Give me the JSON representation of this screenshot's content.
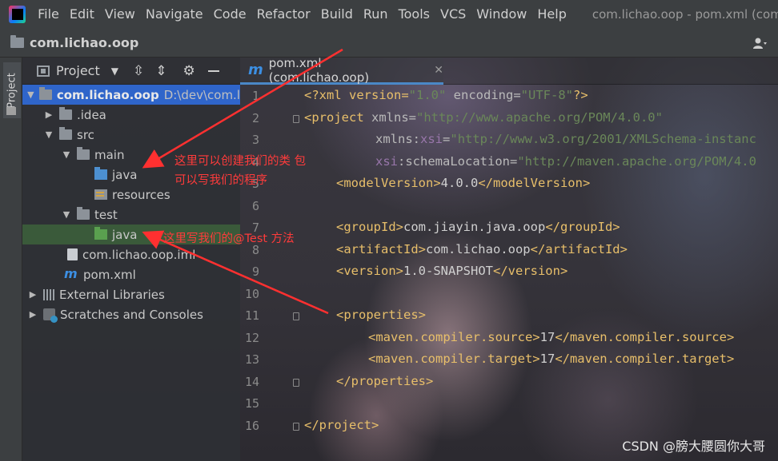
{
  "menu": {
    "items": [
      "File",
      "Edit",
      "View",
      "Navigate",
      "Code",
      "Refactor",
      "Build",
      "Run",
      "Tools",
      "VCS",
      "Window",
      "Help"
    ],
    "title": "com.lichao.oop - pom.xml (com."
  },
  "nav": {
    "project": "com.lichao.oop"
  },
  "sidestrip": {
    "project_tab": "Project"
  },
  "panel": {
    "title": "Project",
    "tree": [
      {
        "label": "com.lichao.oop",
        "path": "D:\\dev\\com.l"
      },
      {
        "label": ".idea"
      },
      {
        "label": "src"
      },
      {
        "label": "main"
      },
      {
        "label": "java"
      },
      {
        "label": "resources"
      },
      {
        "label": "test"
      },
      {
        "label": "java"
      },
      {
        "label": "com.lichao.oop.iml"
      },
      {
        "label": "pom.xml"
      },
      {
        "label": "External Libraries"
      },
      {
        "label": "Scratches and Consoles"
      }
    ]
  },
  "editor": {
    "tab": {
      "icon": "m",
      "label": "pom.xml (com.lichao.oop)"
    },
    "line_numbers": [
      "1",
      "2",
      "3",
      "4",
      "5",
      "6",
      "7",
      "8",
      "9",
      "10",
      "11",
      "12",
      "13",
      "14",
      "15",
      "16"
    ],
    "lines": {
      "l1_a": "<?xml version=",
      "l1_b": "\"1.0\"",
      "l1_c": " encoding=",
      "l1_d": "\"UTF-8\"",
      "l1_e": "?>",
      "l2_a": "<project",
      "l2_b": " xmlns=",
      "l2_c": "\"http://www.apache.org/POM/4.0.0\"",
      "l3_a": "xmlns",
      "l3_b": ":",
      "l3_c": "xsi",
      "l3_d": "=",
      "l3_e": "\"http://www.w3.org/2001/XMLSchema-instanc",
      "l4_a": "xsi",
      "l4_b": ":schemaLocation=",
      "l4_c": "\"http://maven.apache.org/POM/4.0",
      "l5_a": "<modelVersion>",
      "l5_b": "4.0.0",
      "l5_c": "</modelVersion>",
      "l7_a": "<groupId>",
      "l7_b": "com.jiayin.java.oop",
      "l7_c": "</groupId>",
      "l8_a": "<artifactId>",
      "l8_b": "com.lichao.oop",
      "l8_c": "</artifactId>",
      "l9_a": "<version>",
      "l9_b": "1.0-SNAPSHOT",
      "l9_c": "</version>",
      "l11": "<properties>",
      "l12_a": "<maven.compiler.source>",
      "l12_b": "17",
      "l12_c": "</maven.compiler.source>",
      "l13_a": "<maven.compiler.target>",
      "l13_b": "17",
      "l13_c": "</maven.compiler.target>",
      "l14": "</properties>",
      "l16": "</project>"
    }
  },
  "annotations": {
    "a1_line1": "这里可以创建我们的类 包",
    "a1_line2": "可以写我们的程序",
    "a2": "这里写我们的@Test 方法"
  },
  "watermark": "CSDN @膀大腰圆你大哥"
}
